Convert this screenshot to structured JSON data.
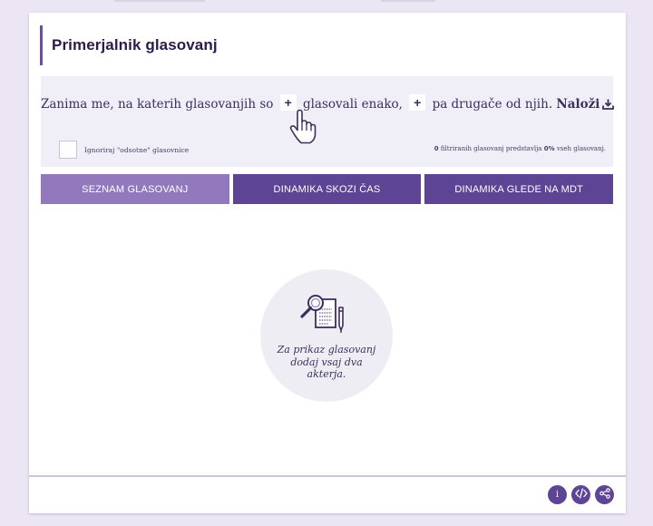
{
  "title": "Primerjalnik glasovanj",
  "query": {
    "prefix": "Zanima me, na katerih glasovanjih so",
    "middle": "glasovali enako,",
    "suffix": "pa drugače od njih.",
    "plus_symbol": "+",
    "load_label": "Naloži",
    "load_icon": "download-icon"
  },
  "ignore_label": "Ignoriraj \"odsotne\" glasovnice",
  "stats": {
    "count": "0",
    "text_a": " filtriranih glasovanj predstavlja ",
    "percent": "0%",
    "text_b": " vseh glasovanj."
  },
  "tabs": [
    {
      "label": "SEZNAM GLASOVANJ",
      "active": true
    },
    {
      "label": "DINAMIKA SKOZI ČAS",
      "active": false
    },
    {
      "label": "DINAMIKA GLEDE NA MDT",
      "active": false
    }
  ],
  "empty_state": {
    "icon": "document-search-icon",
    "text": "Za prikaz glasovanj dodaj vsaj dva akterja."
  },
  "footer": {
    "info_label": "i",
    "embed_icon": "code-icon",
    "share_icon": "share-icon"
  },
  "colors": {
    "accent": "#5e4495",
    "accent_light": "#9279be",
    "text": "#3d2e5c",
    "background": "#ece6f4"
  }
}
